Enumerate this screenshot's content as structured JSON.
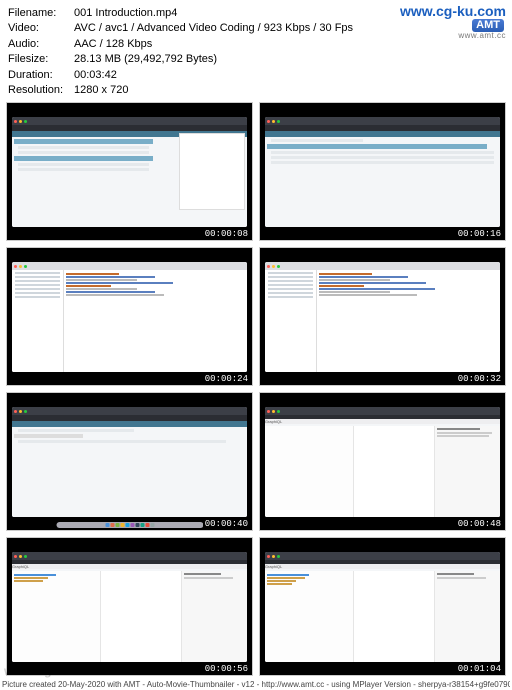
{
  "watermark_top": {
    "main": "www.cg-ku.com",
    "amt": "AMT",
    "sub": "www.amt.cc"
  },
  "watermark_bl": "www.cg-ku.com",
  "meta": {
    "filename_label": "Filename:",
    "filename": "001 Introduction.mp4",
    "video_label": "Video:",
    "video": "AVC / avc1 / Advanced Video Coding / 923 Kbps / 30 Fps",
    "audio_label": "Audio:",
    "audio": "AAC / 128 Kbps",
    "filesize_label": "Filesize:",
    "filesize": "28.13 MB (29,492,792 Bytes)",
    "duration_label": "Duration:",
    "duration": "00:03:42",
    "resolution_label": "Resolution:",
    "resolution": "1280 x 720"
  },
  "thumbs": {
    "t1": {
      "ts": "00:00:08",
      "title": "Site administration"
    },
    "t2": {
      "ts": "00:00:16",
      "title": "Django administration"
    },
    "t3": {
      "ts": "00:00:24",
      "title": "models.py"
    },
    "t4": {
      "ts": "00:00:32",
      "title": "models.py"
    },
    "t5": {
      "ts": "00:00:40",
      "title": "Django administration"
    },
    "t6": {
      "ts": "00:00:48",
      "title": "GraphiQL"
    },
    "t7": {
      "ts": "00:00:56",
      "title": "GraphiQL"
    },
    "t8": {
      "ts": "00:01:04",
      "title": "GraphiQL"
    }
  },
  "graphiql": {
    "header": "GraphiQL",
    "docs": "Documentation Explorer"
  },
  "footer": "Picture created 20-May-2020 with AMT - Auto-Movie-Thumbnailer - v12 - http://www.amt.cc - using MPlayer Version - sherpya-r38154+g9fe07908c3-8.3-win32"
}
